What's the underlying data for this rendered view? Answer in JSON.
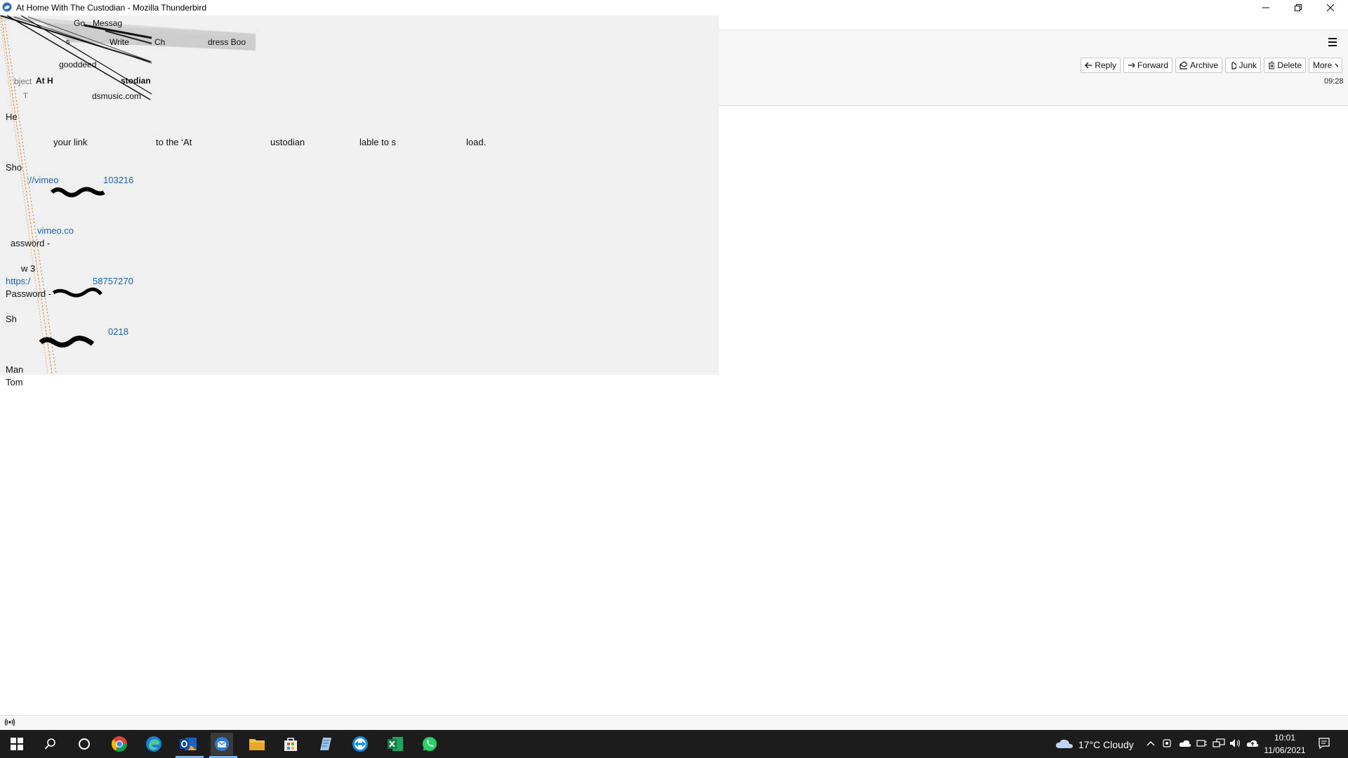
{
  "window": {
    "title": "At Home With The Custodian - Mozilla Thunderbird"
  },
  "left_fragments": {
    "menu_go": "Go",
    "menu_message": "Messag",
    "tb_s": "s",
    "tb_write": "Write",
    "tb_ch": "Ch",
    "tb_address_book": "dress Boo",
    "from_goodeed": "gooddeed",
    "subject_label": "bject",
    "subject_value_a": "At H",
    "subject_value_b": "stodian",
    "to_label": "T",
    "to_value": "dsmusic.com",
    "body_he": "He",
    "body_your_link": "your link",
    "body_to_the_at": "to the ‘At",
    "body_custodian": "ustodian",
    "body_able": "lable to s",
    "body_load": "load.",
    "body_sho": "Sho",
    "link_vimeo1": "://vimeo",
    "link_num1": "103216",
    "link_vimeo2": "vimeo.co",
    "body_password1": "assword -",
    "body_w3": "w 3",
    "link_https": "https:/",
    "link_num2": "58757270",
    "body_password2": "Password -",
    "body_sh": "Sh",
    "link_num3": "0218",
    "body_man": "Man",
    "body_tom": "Tom"
  },
  "toolbar": {
    "reply": "Reply",
    "forward": "Forward",
    "archive": "Archive",
    "junk": "Junk",
    "delete": "Delete",
    "more": "More"
  },
  "header": {
    "time": "09:28"
  },
  "taskbar": {
    "weather": "17°C  Cloudy",
    "time": "10:01",
    "date": "11/06/2021"
  }
}
